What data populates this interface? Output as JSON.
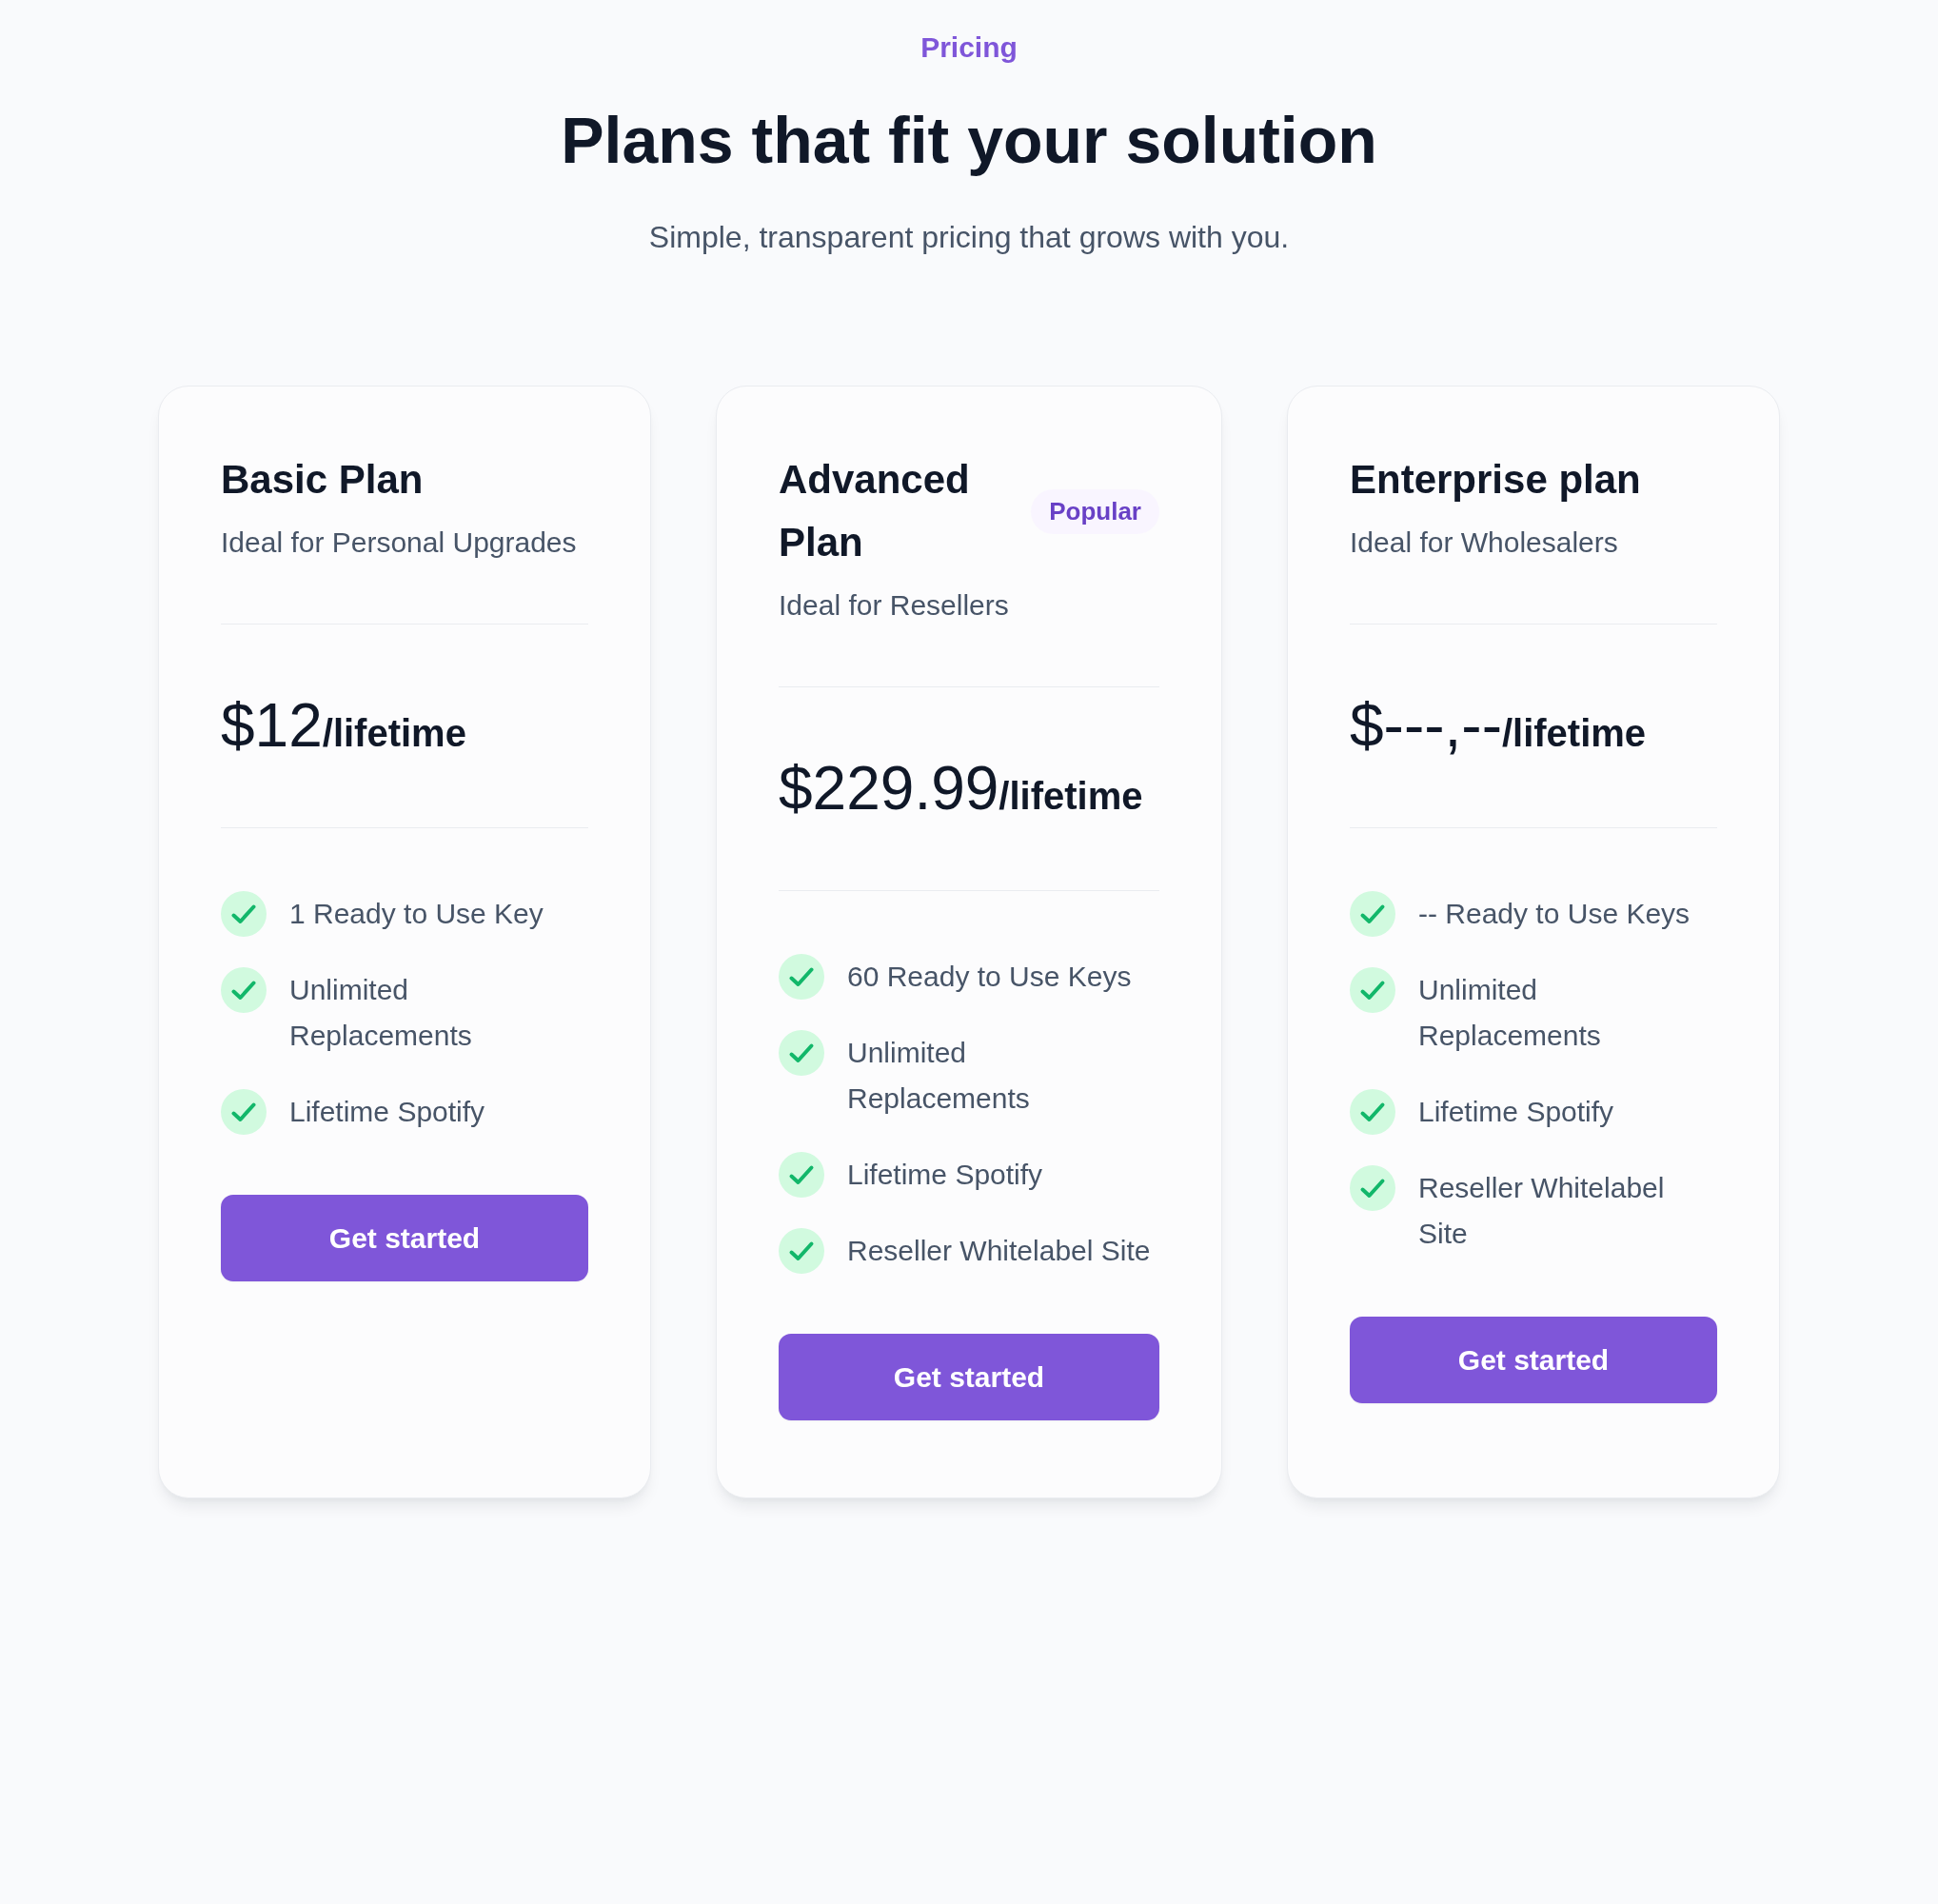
{
  "header": {
    "eyebrow": "Pricing",
    "title": "Plans that fit your solution",
    "subtitle": "Simple, transparent pricing that grows with you."
  },
  "plans": [
    {
      "name": "Basic Plan",
      "description": "Ideal for Personal Upgrades",
      "price": "$12",
      "period": "/lifetime",
      "features": [
        "1 Ready to Use Key",
        "Unlimited Replacements",
        "Lifetime Spotify"
      ],
      "button": "Get started"
    },
    {
      "name": "Advanced Plan",
      "badge": "Popular",
      "description": "Ideal for Resellers",
      "price": "$229.99",
      "period": "/lifetime",
      "features": [
        "60 Ready to Use Keys",
        "Unlimited Replacements",
        "Lifetime Spotify",
        "Reseller Whitelabel Site"
      ],
      "button": "Get started"
    },
    {
      "name": "Enterprise plan",
      "description": "Ideal for Wholesalers",
      "price": "$---,--",
      "period": "/lifetime",
      "features": [
        "-- Ready to Use Keys",
        "Unlimited Replacements",
        "Lifetime Spotify",
        "Reseller Whitelabel Site"
      ],
      "button": "Get started"
    }
  ]
}
